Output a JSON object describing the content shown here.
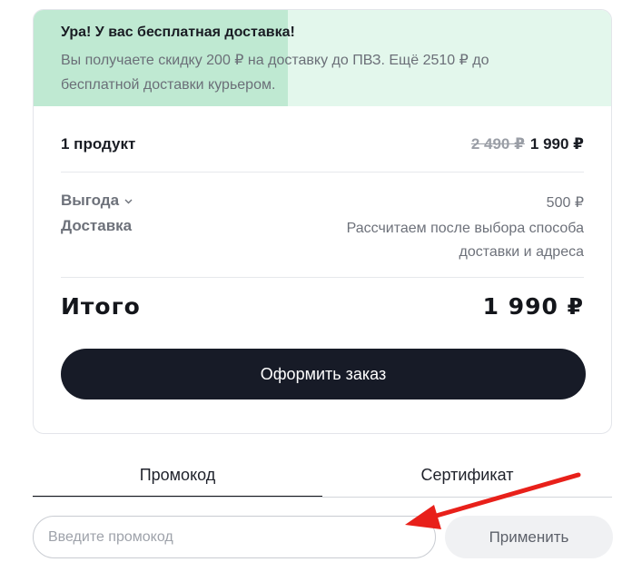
{
  "banner": {
    "title": "Ура! У вас бесплатная доставка!",
    "text": "Вы получаете скидку 200 ₽ на доставку до ПВЗ. Ещё 2510 ₽ до бесплатной доставки курьером.",
    "progress_fraction": 0.44,
    "fill_color": "#bfe9d2",
    "bg_color": "#e3f7ec"
  },
  "summary": {
    "products_label": "1 продукт",
    "old_price": "2 490 ₽",
    "new_price": "1 990 ₽",
    "benefit_label": "Выгода",
    "benefit_value": "500 ₽",
    "delivery_label": "Доставка",
    "delivery_value": "Рассчитаем после выбора способа доставки и адреса",
    "total_label": "Итого",
    "total_value": "1 990 ₽",
    "checkout_label": "Оформить заказ"
  },
  "tabs": [
    {
      "label": "Промокод",
      "active": true
    },
    {
      "label": "Сертификат",
      "active": false
    }
  ],
  "promo": {
    "placeholder": "Введите промокод",
    "value": "",
    "apply_label": "Применить"
  },
  "icons": {
    "chevron": "chevron-down-icon",
    "annotation": "red-arrow-icon"
  },
  "colors": {
    "button_dark": "#171b27",
    "arrow_red": "#e8201a"
  }
}
